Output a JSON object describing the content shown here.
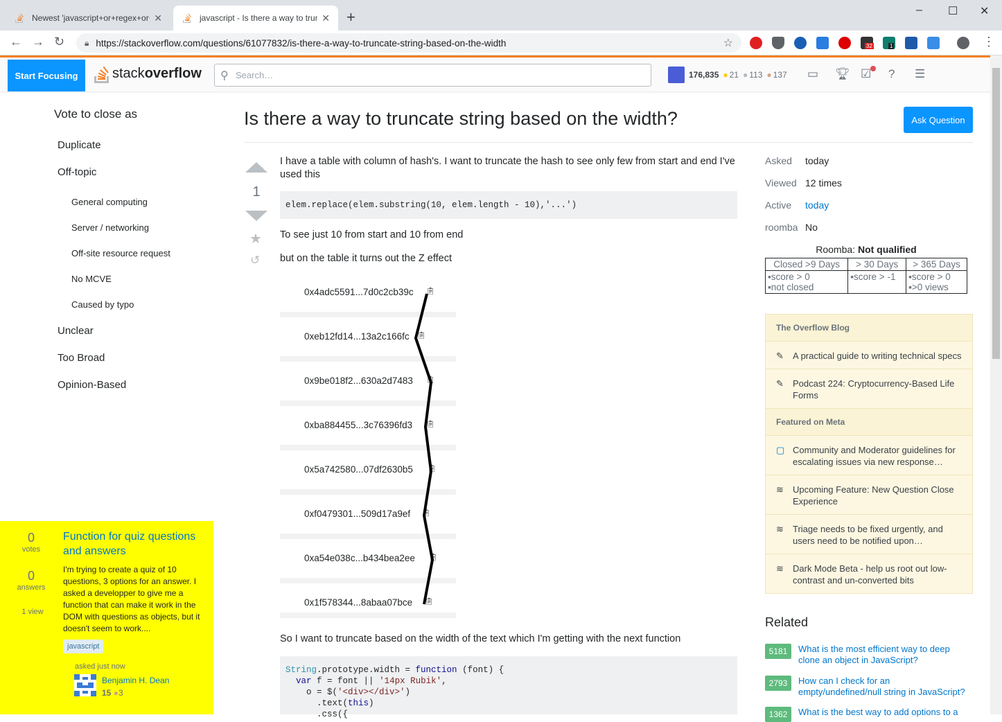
{
  "browser": {
    "tabs": [
      {
        "title": "Newest 'javascript+or+regex+or+",
        "active": false
      },
      {
        "title": "javascript - Is there a way to trun",
        "active": true
      }
    ],
    "url": "https://stackoverflow.com/questions/61077832/is-there-a-way-to-truncate-string-based-on-the-width",
    "new_tab": "+",
    "minimize": "–",
    "maximize": "☐",
    "close": "✕",
    "ext_badges": [
      "32",
      "1"
    ]
  },
  "topbar": {
    "focus_button": "Start Focusing",
    "logo_text_a": "stack",
    "logo_text_b": "overflow",
    "search_placeholder": "Search…",
    "reputation": "176,835",
    "gold": "21",
    "silver": "113",
    "bronze": "137"
  },
  "vote_close": {
    "title": "Vote to close as",
    "items": [
      "Duplicate",
      "Off-topic",
      "Unclear",
      "Too Broad",
      "Opinion-Based"
    ],
    "offtopic_subitems": [
      "General computing",
      "Server / networking",
      "Off-site resource request",
      "No MCVE",
      "Caused by typo"
    ]
  },
  "suggested_question": {
    "votes": "0",
    "votes_label": "votes",
    "answers": "0",
    "answers_label": "answers",
    "views": "1 view",
    "title": "Function for quiz questions and answers",
    "excerpt": "I'm trying to create a quiz of 10 questions, 3 options for an answer. I asked a developper to give me a function that can make it work in the DOM with questions as objects, but it doesn't seem to work....",
    "tag": "javascript",
    "asked": "asked just now",
    "user": "Benjamin H. Dean",
    "user_rep": "15",
    "user_bronze": "3"
  },
  "question": {
    "title": "Is there a way to truncate string based on the width?",
    "ask_button": "Ask Question",
    "score": "1",
    "p1": "I have a table with column of hash's. I want to truncate the hash to see only few from start and end I've used this",
    "code1": "elem.replace(elem.substring(10, elem.length - 10),'...')",
    "p2": "To see just 10 from start and 10 from end",
    "p3": "but on the table it turns out the Z effect",
    "hashes": [
      "0x4adc5591...7d0c2cb39c",
      "0xeb12fd14...13a2c166fc",
      "0x9be018f2...630a2d7483",
      "0xba884455...3c76396fd3",
      "0x5a742580...07df2630b5",
      "0xf0479301...509d17a9ef",
      "0xa54e038c...b434bea2ee",
      "0x1f578344...8abaa07bce"
    ],
    "p4": "So I want to truncate based on the width of the text which I'm getting with the next function",
    "code2_line1a": "String",
    "code2_line1b": ".prototype.width = ",
    "code2_line1c": "function",
    "code2_line1d": " (font) {",
    "code2_line2a": "  ",
    "code2_line2b": "var",
    "code2_line2c": " f = font || ",
    "code2_line2d": "'14px Rubik'",
    "code2_line2e": ",",
    "code2_line3a": "    o = $(",
    "code2_line3b": "'<div></div>'",
    "code2_line3c": ")",
    "code2_line4a": "      .text(",
    "code2_line4b": "this",
    "code2_line4c": ")",
    "code2_line5": "      .css({"
  },
  "meta": {
    "asked_k": "Asked",
    "asked_v": "today",
    "viewed_k": "Viewed",
    "viewed_v": "12 times",
    "active_k": "Active",
    "active_v": "today",
    "roomba_k": "roomba",
    "roomba_v": "No",
    "roomba_label": "Roomba: ",
    "roomba_status": "Not qualified",
    "roomba_cols": [
      "Closed >9 Days",
      "> 30 Days",
      "> 365 Days"
    ],
    "roomba_rows": [
      [
        "score > 0",
        "score > -1",
        "score > 0"
      ],
      [
        "not closed",
        "",
        ">0 views"
      ]
    ]
  },
  "blog": {
    "blog_heading": "The Overflow Blog",
    "blog_items": [
      "A practical guide to writing technical specs",
      "Podcast 224: Cryptocurrency-Based Life Forms"
    ],
    "meta_heading": "Featured on Meta",
    "meta_items": [
      "Community and Moderator guidelines for escalating issues via new response…",
      "Upcoming Feature: New Question Close Experience",
      "Triage needs to be fixed urgently, and users need to be notified upon…",
      "Dark Mode Beta - help us root out low-contrast and un-converted bits"
    ]
  },
  "related": {
    "heading": "Related",
    "items": [
      {
        "score": "5181",
        "title": "What is the most efficient way to deep clone an object in JavaScript?"
      },
      {
        "score": "2793",
        "title": "How can I check for an empty/undefined/null string in JavaScript?"
      },
      {
        "score": "1362",
        "title": "What is the best way to add options to a"
      }
    ]
  }
}
